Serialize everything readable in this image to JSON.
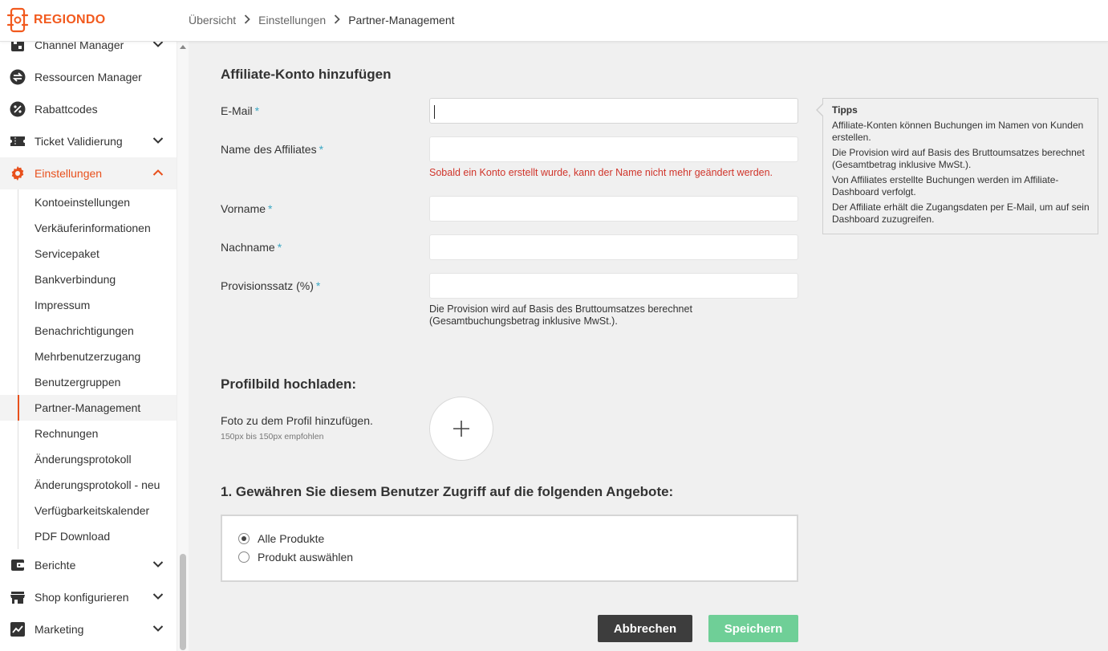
{
  "brand": {
    "name": "REGIONDO",
    "accent": "#f25a1e"
  },
  "breadcrumb": [
    "Übersicht",
    "Einstellungen",
    "Partner-Management"
  ],
  "sidebar": {
    "items": [
      {
        "label": "Channel Manager",
        "icon": "channel-icon",
        "expandable": true
      },
      {
        "label": "Ressourcen Manager",
        "icon": "exchange-icon",
        "expandable": false
      },
      {
        "label": "Rabattcodes",
        "icon": "percent-icon",
        "expandable": false
      },
      {
        "label": "Ticket Validierung",
        "icon": "ticket-icon",
        "expandable": true
      },
      {
        "label": "Einstellungen",
        "icon": "gear-icon",
        "expandable": true,
        "active": true
      }
    ],
    "sub_items": [
      "Kontoeinstellungen",
      "Verkäuferinformationen",
      "Servicepaket",
      "Bankverbindung",
      "Impressum",
      "Benachrichtigungen",
      "Mehrbenutzerzugang",
      "Benutzergruppen",
      "Partner-Management",
      "Rechnungen",
      "Änderungsprotokoll",
      "Änderungsprotokoll - neu",
      "Verfügbarkeitskalender",
      "PDF Download"
    ],
    "selected_sub": "Partner-Management",
    "bottom_items": [
      {
        "label": "Berichte",
        "icon": "wallet-icon"
      },
      {
        "label": "Shop konfigurieren",
        "icon": "store-icon"
      },
      {
        "label": "Marketing",
        "icon": "chart-icon"
      }
    ]
  },
  "form": {
    "title": "Affiliate-Konto hinzufügen",
    "fields": {
      "email": {
        "label": "E-Mail",
        "value": ""
      },
      "affiliate_name": {
        "label": "Name des Affiliates",
        "value": ""
      },
      "firstname": {
        "label": "Vorname",
        "value": ""
      },
      "lastname": {
        "label": "Nachname",
        "value": ""
      },
      "commission": {
        "label": "Provisionssatz (%)",
        "value": ""
      }
    },
    "required_mark": "*",
    "name_warning": "Sobald ein Konto erstellt wurde, kann der Name nicht mehr geändert werden.",
    "commission_help": "Die Provision wird auf Basis des Bruttoumsatzes berechnet (Gesamtbuchungsbetrag inklusive MwSt.)."
  },
  "tips": {
    "title": "Tipps",
    "lines": [
      "Affiliate-Konten können Buchungen im Namen von Kunden erstellen.",
      "Die Provision wird auf Basis des Bruttoumsatzes berechnet (Gesamtbetrag inklusive MwSt.).",
      "Von Affiliates erstellte Buchungen werden im Affiliate-Dashboard verfolgt.",
      "Der Affiliate erhält die Zugangsdaten per E-Mail, um auf sein Dashboard zuzugreifen."
    ]
  },
  "profile": {
    "title": "Profilbild hochladen:",
    "label": "Foto zu dem Profil hinzufügen.",
    "hint": "150px bis 150px empfohlen"
  },
  "access": {
    "title": "1. Gewähren Sie diesem Benutzer Zugriff auf die folgenden Angebote:",
    "options": [
      {
        "label": "Alle Produkte",
        "selected": true
      },
      {
        "label": "Produkt auswählen",
        "selected": false
      }
    ]
  },
  "buttons": {
    "cancel": "Abbrechen",
    "save": "Speichern"
  },
  "colors": {
    "save": "#6fcf97",
    "cancel": "#3d3d3d",
    "warning": "#d0352b",
    "required": "#3aa7c4"
  }
}
